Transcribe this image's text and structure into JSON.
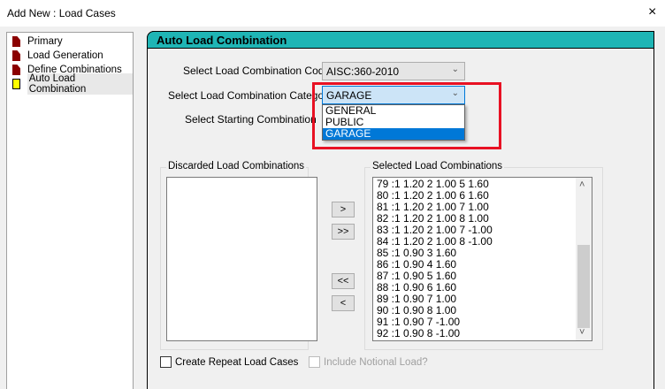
{
  "window": {
    "title": "Add New : Load Cases",
    "close_icon": "×"
  },
  "tree": {
    "items": [
      {
        "label": "Primary",
        "icon": "document-icon"
      },
      {
        "label": "Load Generation",
        "icon": "document-icon"
      },
      {
        "label": "Define Combinations",
        "icon": "document-icon"
      },
      {
        "label": "Auto Load Combination",
        "icon": "yellow-document-icon"
      }
    ]
  },
  "panel": {
    "header": "Auto Load Combination",
    "code_label": "Select Load Combination Code :",
    "code_value": "AISC:360-2010",
    "category_label": "Select Load Combination Category :",
    "category_value": "GARAGE",
    "category_options": [
      "GENERAL",
      "PUBLIC",
      "GARAGE"
    ],
    "start_label": "Select Starting Combination No :",
    "discarded_label": "Discarded Load Combinations",
    "selected_label": "Selected Load Combinations",
    "selected_items": [
      "79 :1 1.20 2 1.00 5 1.60",
      "80 :1 1.20 2 1.00 6 1.60",
      "81 :1 1.20 2 1.00 7 1.00",
      "82 :1 1.20 2 1.00 8 1.00",
      "83 :1 1.20 2 1.00 7 -1.00",
      "84 :1 1.20 2 1.00 8 -1.00",
      "85 :1 0.90 3 1.60",
      "86 :1 0.90 4 1.60",
      "87 :1 0.90 5 1.60",
      "88 :1 0.90 6 1.60",
      "89 :1 0.90 7 1.00",
      "90 :1 0.90 8 1.00",
      "91 :1 0.90 7 -1.00",
      "92 :1 0.90 8 -1.00"
    ],
    "buttons": {
      "add": ">",
      "add_all": ">>",
      "remove_all": "<<",
      "remove": "<"
    },
    "repeat_label": "Create Repeat Load Cases",
    "notional_label": "Include Notional Load?",
    "scroll_up": "˄",
    "scroll_down": "˅",
    "chevron": "⌄"
  },
  "colors": {
    "header": "#1fb5b5",
    "highlight": "#0078d7",
    "red_box": "#e81123"
  }
}
